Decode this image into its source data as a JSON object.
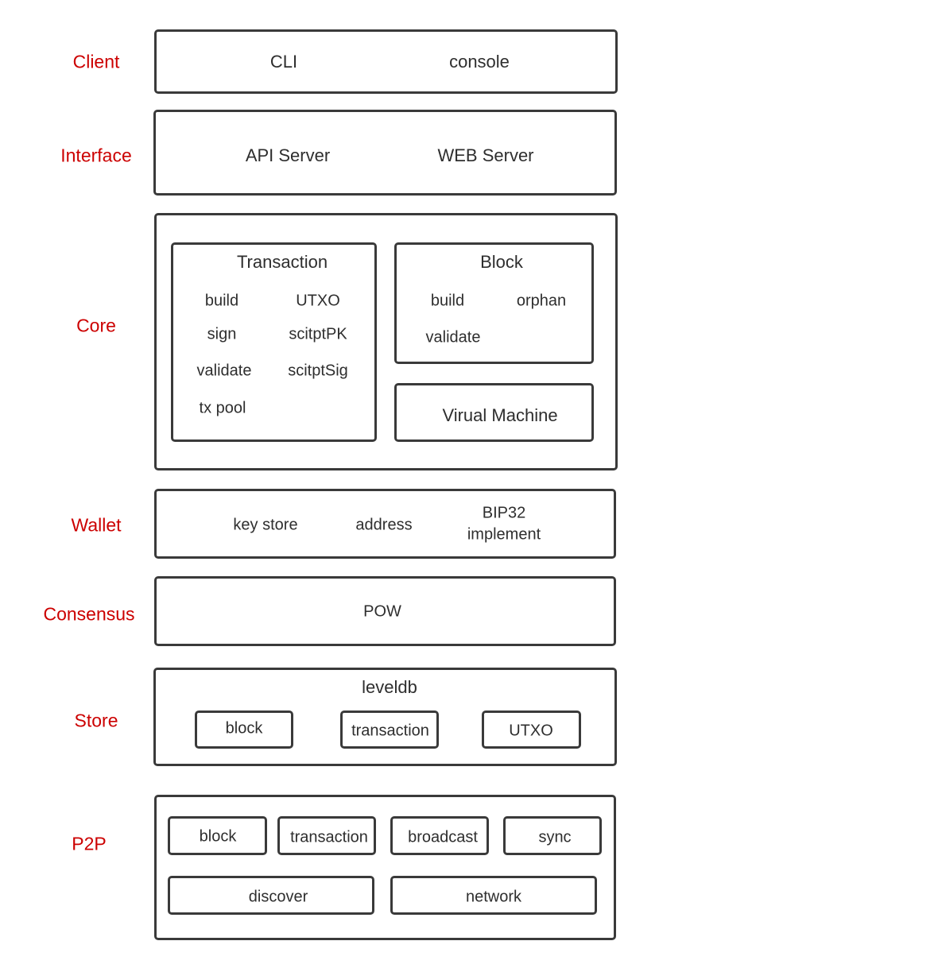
{
  "layers": {
    "client": {
      "label": "Client",
      "items": [
        "CLI",
        "console"
      ]
    },
    "interface": {
      "label": "Interface",
      "items": [
        "API Server",
        "WEB Server"
      ]
    },
    "core": {
      "label": "Core",
      "transaction": {
        "title": "Transaction",
        "items": [
          "build",
          "UTXO",
          "sign",
          "scitptPK",
          "validate",
          "scitptSig",
          "tx pool"
        ]
      },
      "block": {
        "title": "Block",
        "items": [
          "build",
          "orphan",
          "validate"
        ]
      },
      "vm": {
        "title": "Virual Machine"
      }
    },
    "wallet": {
      "label": "Wallet",
      "items": [
        "key store",
        "address",
        "BIP32",
        "implement"
      ]
    },
    "consensus": {
      "label": "Consensus",
      "items": [
        "POW"
      ]
    },
    "store": {
      "label": "Store",
      "title": "leveldb",
      "items": [
        "block",
        "transaction",
        "UTXO"
      ]
    },
    "p2p": {
      "label": "P2P",
      "items": [
        "block",
        "transaction",
        "broadcast",
        "sync",
        "discover",
        "network"
      ]
    }
  },
  "colors": {
    "label": "#cc0000",
    "border": "#3a3a3a",
    "text": "#2e2e2e"
  }
}
